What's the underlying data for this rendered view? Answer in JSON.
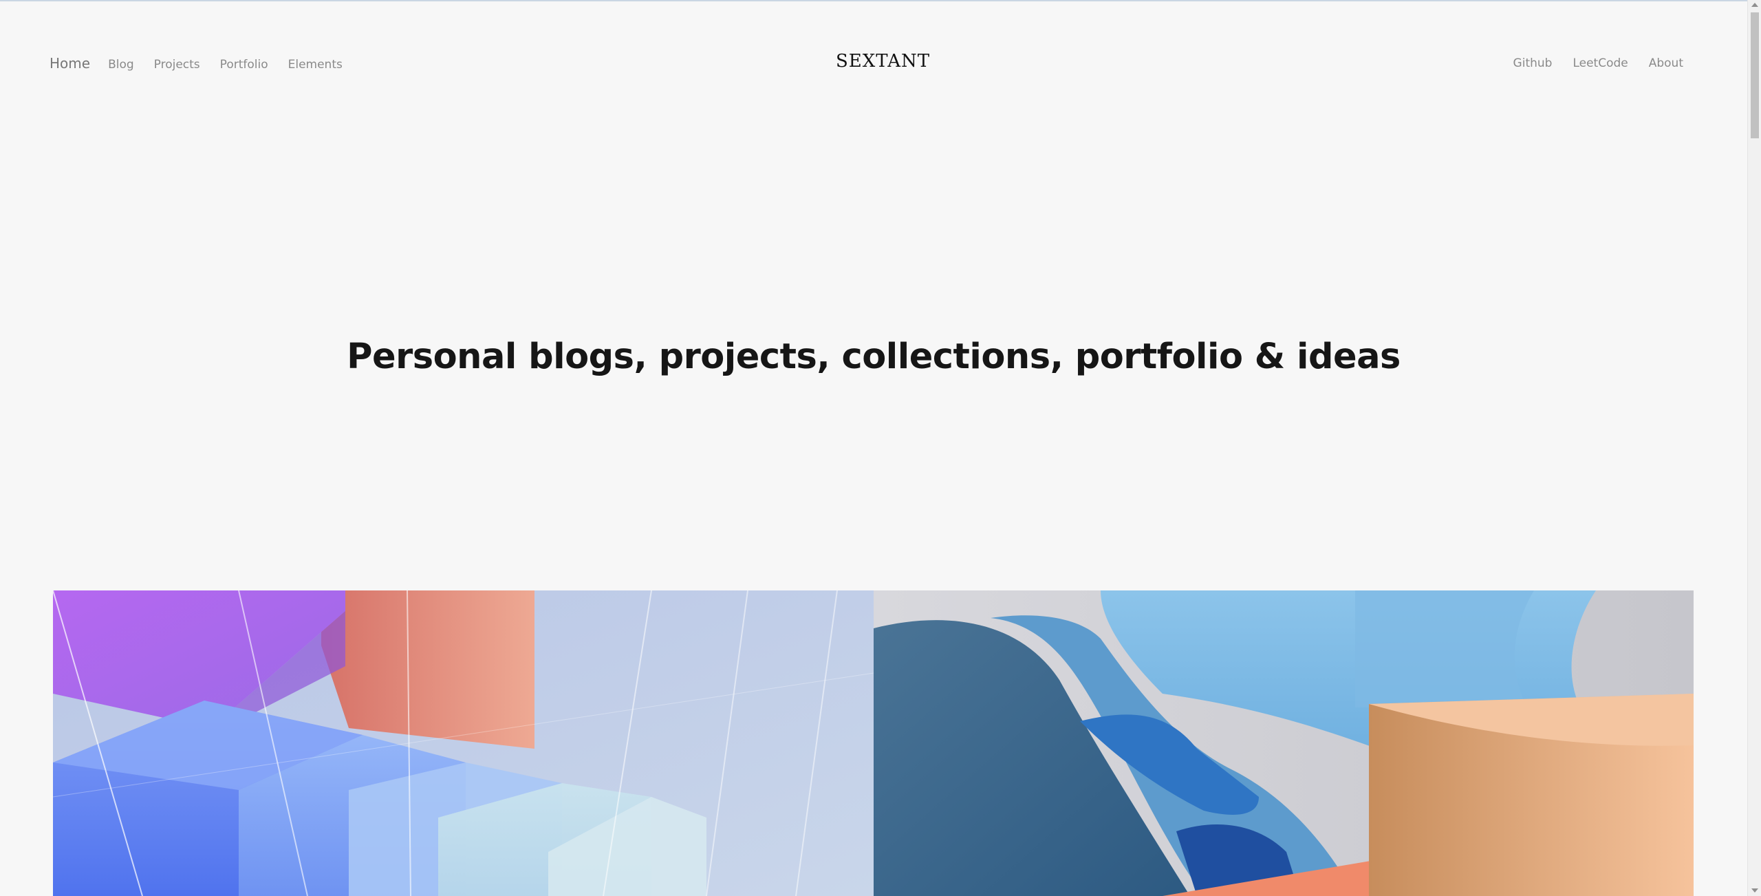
{
  "header": {
    "brand": "SEXTANT",
    "nav_left": [
      {
        "label": "Home"
      },
      {
        "label": "Blog"
      },
      {
        "label": "Projects"
      },
      {
        "label": "Portfolio"
      },
      {
        "label": "Elements"
      }
    ],
    "nav_right": [
      {
        "label": "Github"
      },
      {
        "label": "LeetCode"
      },
      {
        "label": "About"
      }
    ]
  },
  "hero": {
    "title": "Personal blogs, projects, collections, portfolio & ideas"
  },
  "gallery": {
    "tiles": [
      {
        "icon": "abstract-glass-blocks-image"
      },
      {
        "icon": "abstract-blue-waves-image"
      }
    ]
  },
  "colors": {
    "background": "#f7f7f7",
    "text": "#161616",
    "nav_text": "#8a8a8a"
  }
}
